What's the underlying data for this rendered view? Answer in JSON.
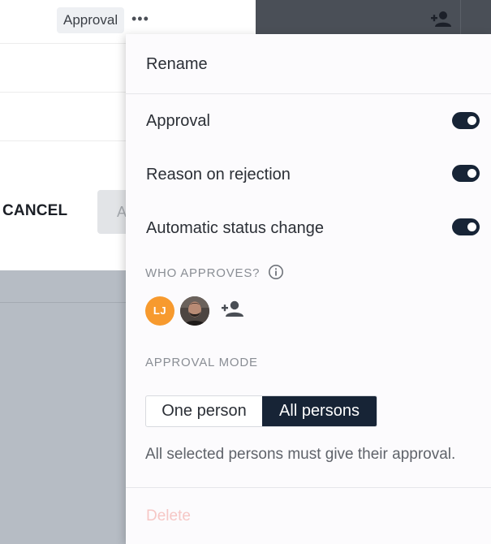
{
  "background": {
    "approval_chip": "Approval",
    "more_icon": "ellipsis-horizontal-icon",
    "cancel_label": "CANCEL",
    "primary_btn_label": "A",
    "add_person_icon": "person-add-icon"
  },
  "menu": {
    "rename_label": "Rename",
    "toggles": [
      {
        "label": "Approval",
        "on": true
      },
      {
        "label": "Reason on rejection",
        "on": true
      },
      {
        "label": "Automatic status change",
        "on": true
      }
    ],
    "who_approves_label": "WHO APPROVES?",
    "info_icon": "info-circle-icon",
    "approvers": [
      {
        "initials": "LJ",
        "color": "#f79a2e"
      },
      {
        "kind": "photo"
      }
    ],
    "add_approver_icon": "person-add-icon",
    "approval_mode_label": "APPROVAL MODE",
    "mode_options": [
      "One person",
      "All persons"
    ],
    "selected_mode": "All persons",
    "mode_description": "All selected persons must give their approval.",
    "delete_label": "Delete"
  },
  "colors": {
    "accent": "#172436",
    "avatar_lj": "#f79a2e",
    "delete_text": "#f6c7c5"
  }
}
